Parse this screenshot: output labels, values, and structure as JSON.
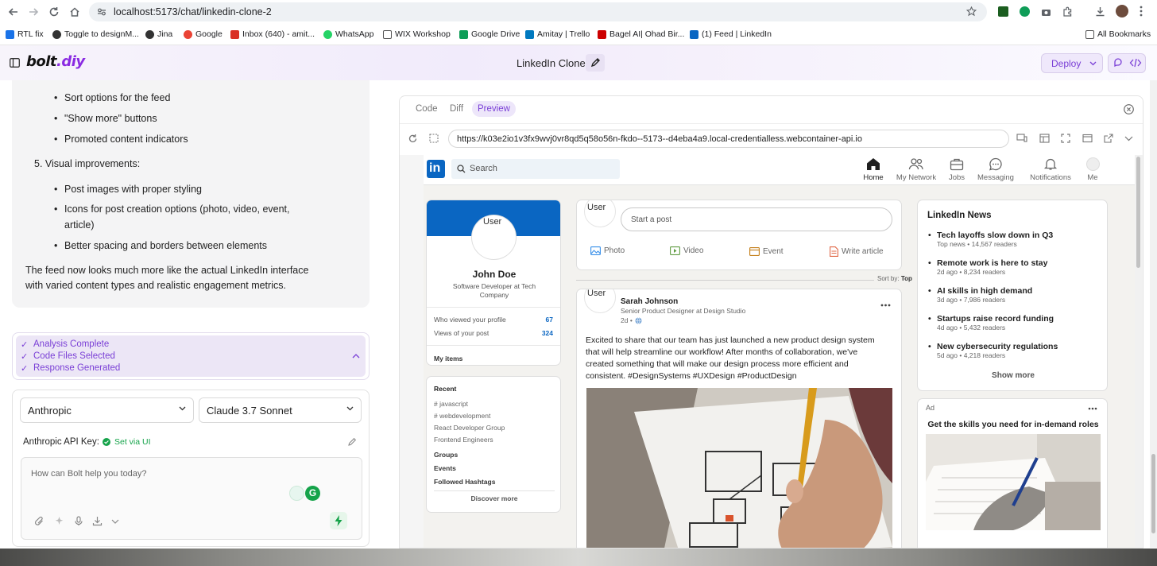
{
  "browser": {
    "url": "localhost:5173/chat/linkedin-clone-2",
    "bookmarks": [
      {
        "label": "RTL fix",
        "color": "#1a73e8"
      },
      {
        "label": "Toggle to designM...",
        "color": "#333333"
      },
      {
        "label": "Jina",
        "color": "#333333"
      },
      {
        "label": "Google",
        "color": "#ea4335"
      },
      {
        "label": "Inbox (640) - amit...",
        "color": "#d93025"
      },
      {
        "label": "WhatsApp",
        "color": "#25d366"
      },
      {
        "label": "WIX Workshop",
        "color": "#555555"
      },
      {
        "label": "Google Drive",
        "color": "#0f9d58"
      },
      {
        "label": "Amitay | Trello",
        "color": "#0079bf"
      },
      {
        "label": "Bagel AI| Ohad Bir...",
        "color": "#cc0000"
      },
      {
        "label": "(1) Feed | LinkedIn",
        "color": "#0a66c2"
      }
    ],
    "all_bookmarks": "All Bookmarks"
  },
  "app": {
    "logo_main": "bolt",
    "logo_suffix": ".diy",
    "project_title": "LinkedIn Clone",
    "deploy_label": "Deploy",
    "accent": "#7a3fd6"
  },
  "chat": {
    "bullets_top": [
      "Sort options for the feed",
      "\"Show more\" buttons",
      "Promoted content indicators"
    ],
    "section_5": "5. Visual improvements:",
    "bullets_5": [
      "Post images with proper styling",
      "Icons for post creation options (photo, video, event,",
      "article)",
      "Better spacing and borders between elements"
    ],
    "summary_line1": "The feed now looks much more like the actual LinkedIn interface",
    "summary_line2": "with varied content types and realistic engagement metrics."
  },
  "progress": [
    "Analysis Complete",
    "Code Files Selected",
    "Response Generated"
  ],
  "input": {
    "provider": "Anthropic",
    "model": "Claude 3.7 Sonnet",
    "api_key_label": "Anthropic API Key:",
    "api_key_status": "Set via UI",
    "placeholder": "How can Bolt help you today?"
  },
  "preview": {
    "tabs": [
      "Code",
      "Diff",
      "Preview"
    ],
    "url": "https://k03e2io1v3fx9wvj0vr8qd5q58o56n-fkdo--5173--d4eba4a9.local-credentialless.webcontainer-api.io"
  },
  "linkedin": {
    "search_placeholder": "Search",
    "nav": [
      "Home",
      "My Network",
      "Jobs",
      "Messaging",
      "Notifications",
      "Me"
    ],
    "profile": {
      "avatar_alt": "User",
      "name": "John Doe",
      "headline_line1": "Software Developer at Tech",
      "headline_line2": "Company",
      "stats": [
        {
          "label": "Who viewed your profile",
          "value": "67"
        },
        {
          "label": "Views of your post",
          "value": "324"
        }
      ],
      "my_items": "My items"
    },
    "recent": {
      "title": "Recent",
      "items": [
        "# javascript",
        "# webdevelopment",
        "React Developer Group",
        "Frontend Engineers"
      ],
      "groups": "Groups",
      "events": "Events",
      "hashtags": "Followed Hashtags",
      "discover": "Discover more"
    },
    "composer": {
      "avatar_alt": "User",
      "placeholder": "Start a post",
      "actions": [
        "Photo",
        "Video",
        "Event",
        "Write article"
      ]
    },
    "sort": {
      "label": "Sort by:",
      "value": "Top"
    },
    "post": {
      "avatar_alt": "User",
      "author": "Sarah Johnson",
      "headline": "Senior Product Designer at Design Studio",
      "time": "2d •",
      "text": [
        "Excited to share that our team has just launched a new product design system",
        "that will help streamline our workflow! After months of collaboration, we've",
        "created something that will make our design process more efficient and",
        "consistent. #DesignSystems #UXDesign #ProductDesign"
      ]
    },
    "news": {
      "title": "LinkedIn News",
      "items": [
        {
          "title": "Tech layoffs slow down in Q3",
          "meta": "Top news • 14,567 readers"
        },
        {
          "title": "Remote work is here to stay",
          "meta": "2d ago • 8,234 readers"
        },
        {
          "title": "AI skills in high demand",
          "meta": "3d ago • 7,986 readers"
        },
        {
          "title": "Startups raise record funding",
          "meta": "4d ago • 5,432 readers"
        },
        {
          "title": "New cybersecurity regulations",
          "meta": "5d ago • 4,218 readers"
        }
      ],
      "show_more": "Show more"
    },
    "ad": {
      "badge": "Ad",
      "title": "Get the skills you need for in-demand roles"
    }
  }
}
